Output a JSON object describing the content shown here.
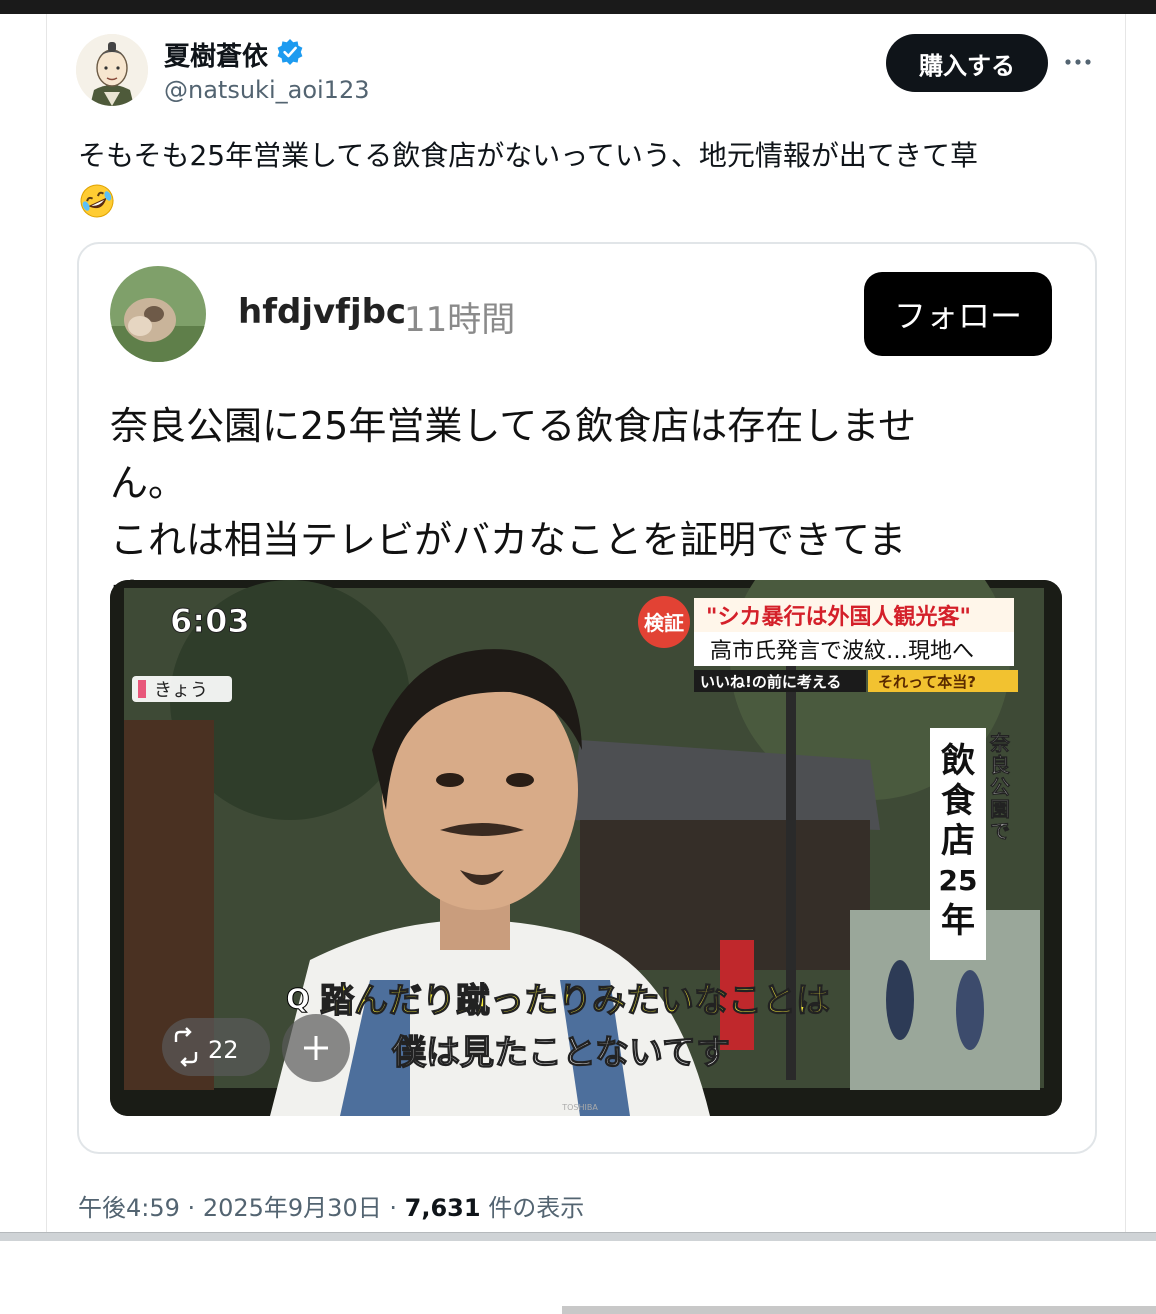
{
  "author": {
    "display_name": "夏樹蒼依",
    "handle": "@natsuki_aoi123",
    "verified": true
  },
  "header": {
    "buy_label": "購入する",
    "more_icon": "more-horizontal-icon"
  },
  "tweet": {
    "text": "そもそも25年営業してる飲食店がないっていう、地元情報が出てきて草",
    "emoji": "🤣"
  },
  "quote": {
    "user": "hfdjvfjbc",
    "time": "11時間",
    "follow_label": "フォロー",
    "text_line1": "奈良公園に25年営業してる飲食店は存在しませ",
    "text_line2": "ん。",
    "text_line3": "これは相当テレビがバカなことを証明できてます。"
  },
  "video": {
    "clock": "6:03",
    "today_tag": "きょう",
    "badge": "検証",
    "headline1": "\"シカ暴行は外国人観光客\"",
    "headline2": "高市氏発言で波紋…現地へ",
    "tagline_left": "いいね!の前に考える",
    "tagline_right": "それって本当?",
    "vertical_small": "奈良公園で",
    "vertical_big": "飲食店25年",
    "q_mark": "Q",
    "subtitle1": "踏んだり蹴ったりみたいなことは",
    "subtitle2": "僕は見たことないてす",
    "repost_count": "22",
    "brand": "TOSHIBA"
  },
  "footer": {
    "time": "午後4:59",
    "sep": "·",
    "date": "2025年9月30日",
    "views": "7,631",
    "views_label": "件の表示"
  },
  "colors": {
    "buy_button_bg": "#0f1419",
    "verified_blue": "#1d9bf0",
    "headline_red": "#d4202a",
    "subtitle_yellow": "#f4ea3a"
  }
}
